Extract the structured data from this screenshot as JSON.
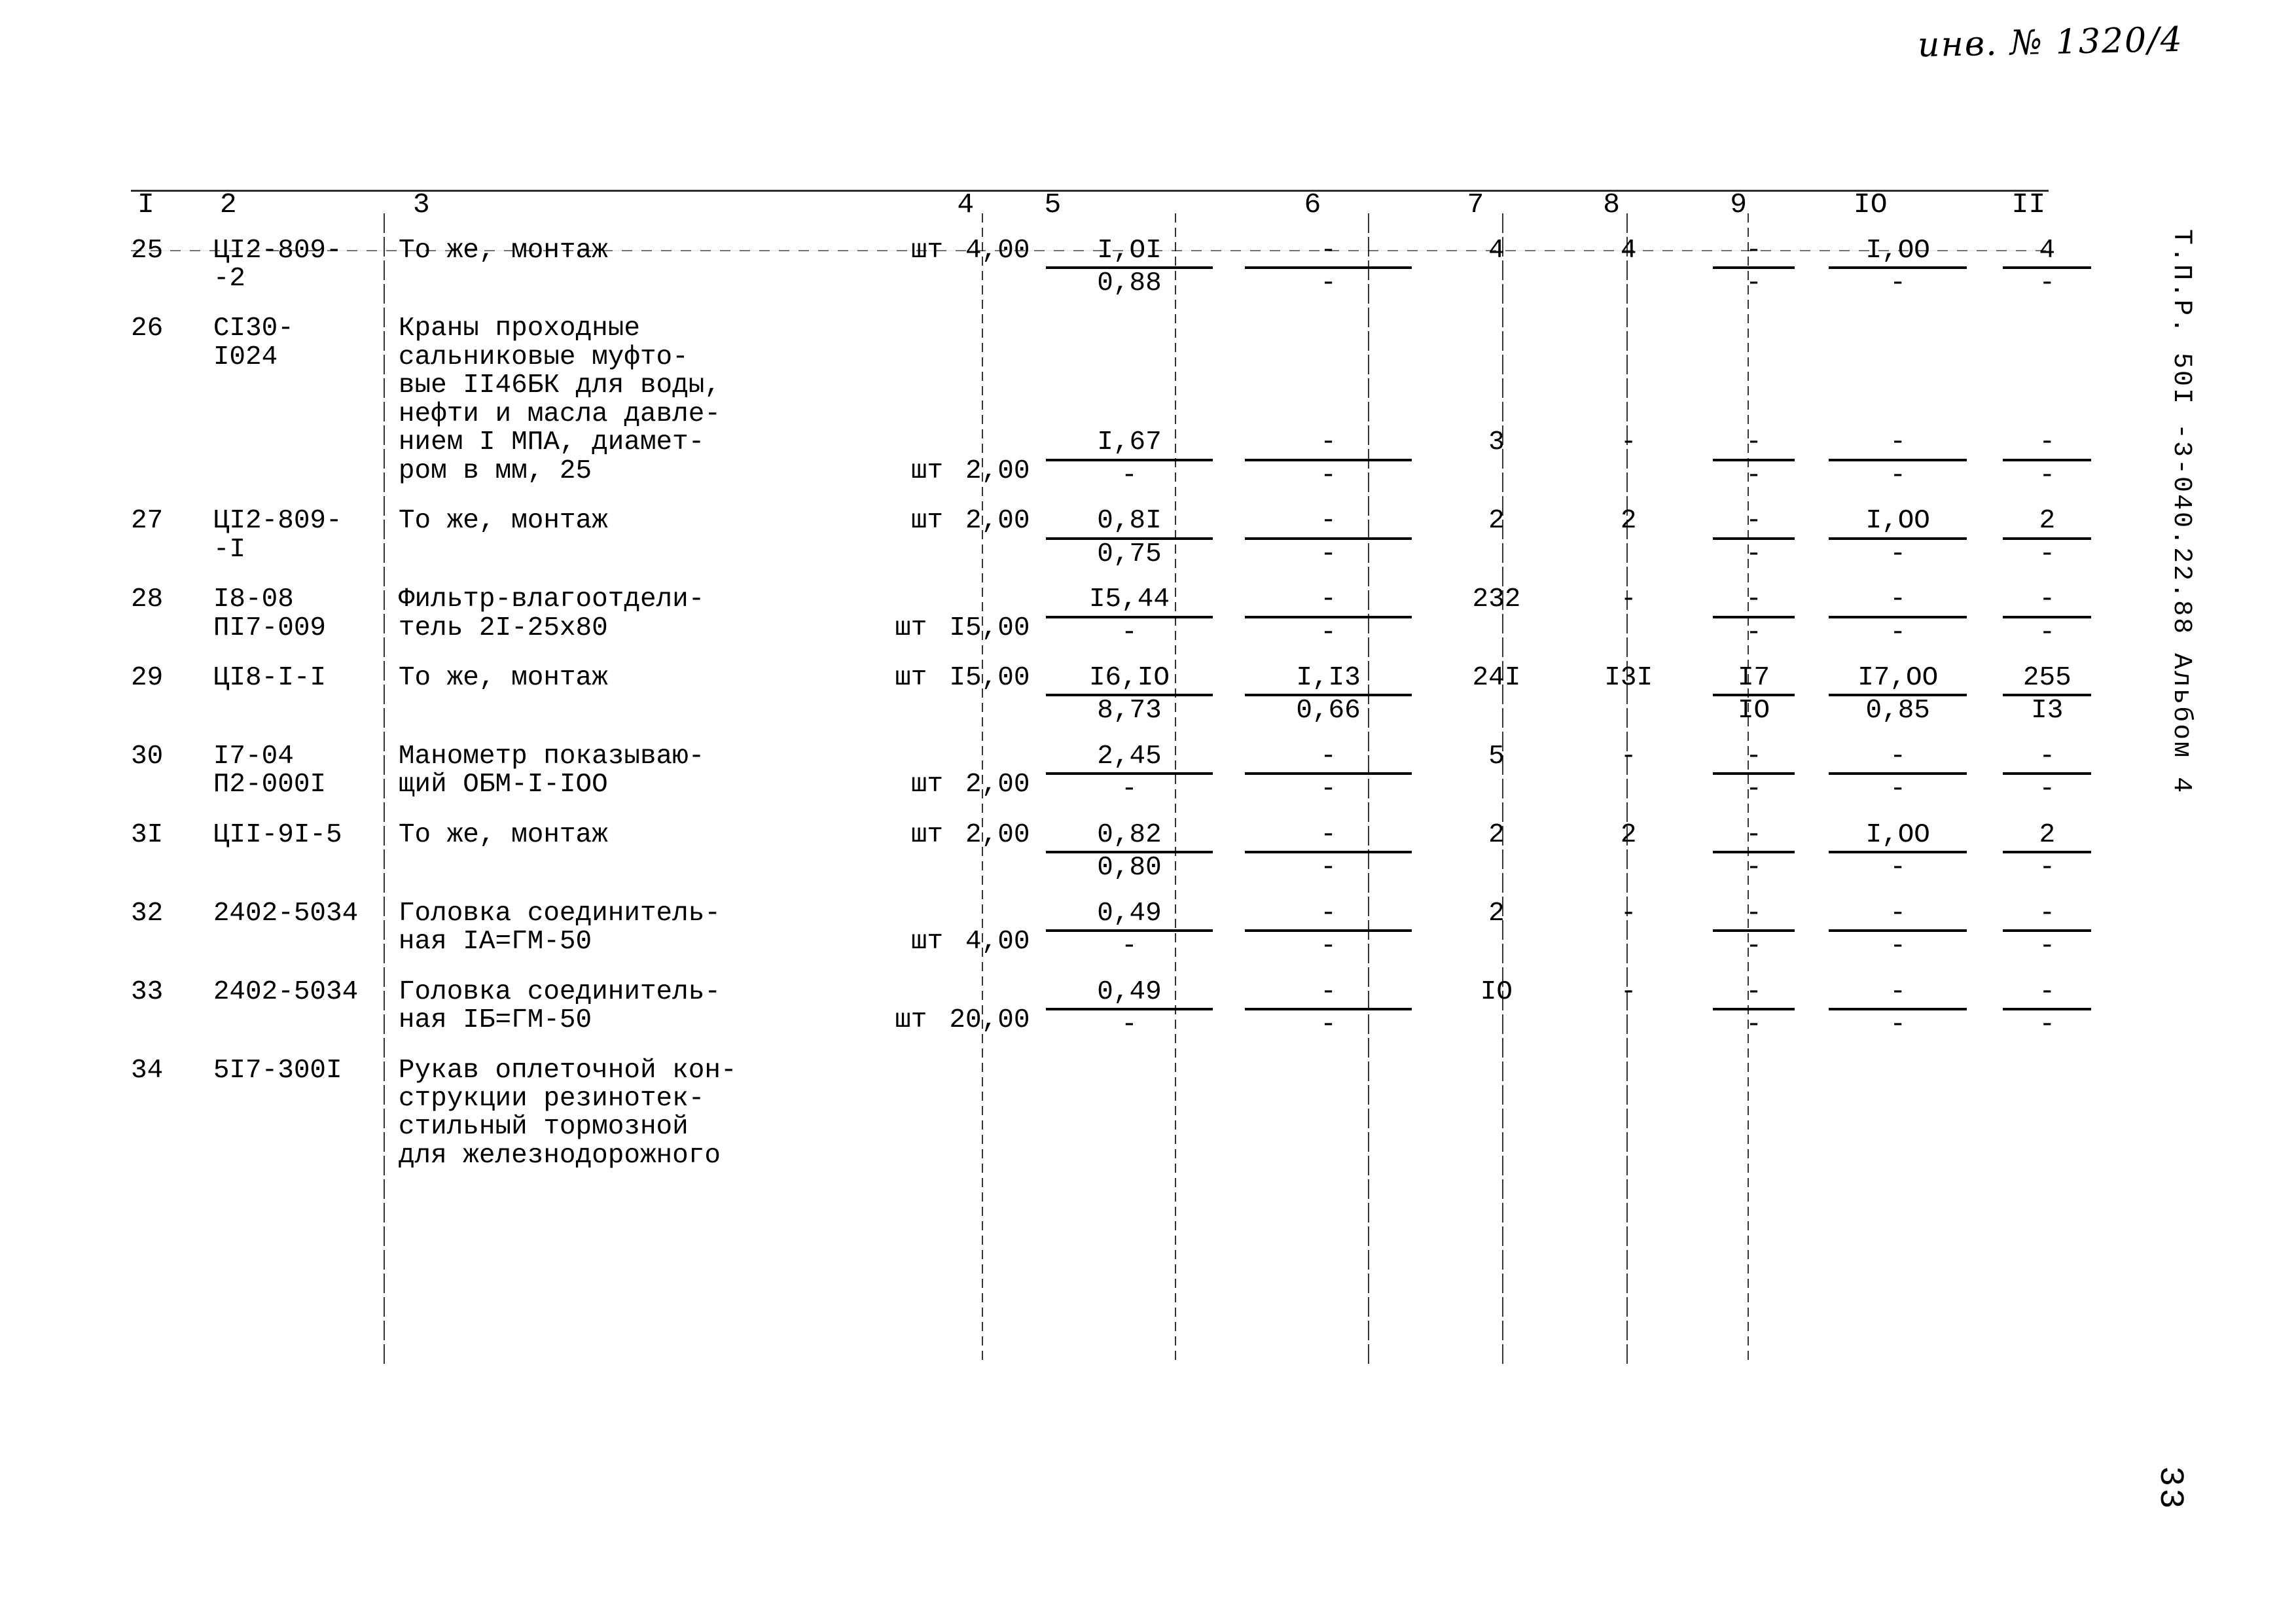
{
  "document": {
    "inventory_number": "инв. № 1320/4",
    "side_stamp": "Т.П.Р. 50I -3-040.22.88  Альбом 4",
    "page_number": "33"
  },
  "table": {
    "column_headers": [
      "I",
      "2",
      "3",
      "4",
      "5",
      "6",
      "7",
      "8",
      "9",
      "IO",
      "II"
    ],
    "rows": [
      {
        "n": "25",
        "code": "ЦI2-809-\n-2",
        "desc": "То же, монтаж",
        "unit": "шт",
        "qty": "4,00",
        "c5_top": "I,OI",
        "c5_bot": "0,88",
        "c6_top": "-",
        "c6_bot": "-",
        "c7": "4",
        "c8": "4",
        "c9_top": "-",
        "c9_bot": "-",
        "c10_top": "I,OO",
        "c10_bot": "-",
        "c11_top": "4",
        "c11_bot": "-"
      },
      {
        "n": "26",
        "code": "CI30-\nI024",
        "desc": "Краны проходные\nсальниковые муфто-\nвые II46БК для воды,\nнефти и масла давле-\nнием I МПА, диамет-\nром в мм, 25",
        "unit": "шт",
        "qty": "2,00",
        "c5_top": "I,67",
        "c5_bot": "-",
        "c6_top": "-",
        "c6_bot": "-",
        "c7": "3",
        "c8": "-",
        "c9_top": "-",
        "c9_bot": "-",
        "c10_top": "-",
        "c10_bot": "-",
        "c11_top": "-",
        "c11_bot": "-"
      },
      {
        "n": "27",
        "code": "ЦI2-809-\n-I",
        "desc": "То же, монтаж",
        "unit": "шт",
        "qty": "2,00",
        "c5_top": "0,8I",
        "c5_bot": "0,75",
        "c6_top": "-",
        "c6_bot": "-",
        "c7": "2",
        "c8": "2",
        "c9_top": "-",
        "c9_bot": "-",
        "c10_top": "I,OO",
        "c10_bot": "-",
        "c11_top": "2",
        "c11_bot": "-"
      },
      {
        "n": "28",
        "code": "I8-08\nПI7-009",
        "desc": "Фильтр-влагоотдели-\nтель 2I-25x80",
        "unit": "шт",
        "qty": "I5,00",
        "c5_top": "I5,44",
        "c5_bot": "-",
        "c6_top": "-",
        "c6_bot": "-",
        "c7": "232",
        "c8": "-",
        "c9_top": "-",
        "c9_bot": "-",
        "c10_top": "-",
        "c10_bot": "-",
        "c11_top": "-",
        "c11_bot": "-"
      },
      {
        "n": "29",
        "code": "ЦI8-I-I",
        "desc": "То же, монтаж",
        "unit": "шт",
        "qty": "I5,00",
        "c5_top": "I6,IO",
        "c5_bot": "8,73",
        "c6_top": "I,I3",
        "c6_bot": "0,66",
        "c7": "24I",
        "c8": "I3I",
        "c9_top": "I7",
        "c9_bot": "IO",
        "c10_top": "I7,OO",
        "c10_bot": "0,85",
        "c11_top": "255",
        "c11_bot": "I3"
      },
      {
        "n": "30",
        "code": "I7-04\nП2-000I",
        "desc": "Манометр показываю-\nщий ОБМ-I-IOO",
        "unit": "шт",
        "qty": "2,00",
        "c5_top": "2,45",
        "c5_bot": "-",
        "c6_top": "-",
        "c6_bot": "-",
        "c7": "5",
        "c8": "-",
        "c9_top": "-",
        "c9_bot": "-",
        "c10_top": "-",
        "c10_bot": "-",
        "c11_top": "-",
        "c11_bot": "-"
      },
      {
        "n": "3I",
        "code": "ЦII-9I-5",
        "desc": "То же, монтаж",
        "unit": "шт",
        "qty": "2,00",
        "c5_top": "0,82",
        "c5_bot": "0,80",
        "c6_top": "-",
        "c6_bot": "-",
        "c7": "2",
        "c8": "2",
        "c9_top": "-",
        "c9_bot": "-",
        "c10_top": "I,OO",
        "c10_bot": "-",
        "c11_top": "2",
        "c11_bot": "-"
      },
      {
        "n": "32",
        "code": "2402-5034",
        "desc": "Головка соединитель-\nная IA=ГМ-50",
        "unit": "шт",
        "qty": "4,00",
        "c5_top": "0,49",
        "c5_bot": "-",
        "c6_top": "-",
        "c6_bot": "-",
        "c7": "2",
        "c8": "-",
        "c9_top": "-",
        "c9_bot": "-",
        "c10_top": "-",
        "c10_bot": "-",
        "c11_top": "-",
        "c11_bot": "-"
      },
      {
        "n": "33",
        "code": "2402-5034",
        "desc": "Головка соединитель-\nная IБ=ГМ-50",
        "unit": "шт",
        "qty": "20,00",
        "c5_top": "0,49",
        "c5_bot": "-",
        "c6_top": "-",
        "c6_bot": "-",
        "c7": "IO",
        "c8": "-",
        "c9_top": "-",
        "c9_bot": "-",
        "c10_top": "-",
        "c10_bot": "-",
        "c11_top": "-",
        "c11_bot": "-"
      },
      {
        "n": "34",
        "code": "5I7-300I",
        "desc": "Рукав оплеточной кон-\nструкции резинотек-\nстильный тормозной\nдля железнодорожного",
        "unit": "",
        "qty": "",
        "c5_top": "",
        "c5_bot": "",
        "c6_top": "",
        "c6_bot": "",
        "c7": "",
        "c8": "",
        "c9_top": "",
        "c9_bot": "",
        "c10_top": "",
        "c10_bot": "",
        "c11_top": "",
        "c11_bot": ""
      }
    ]
  }
}
